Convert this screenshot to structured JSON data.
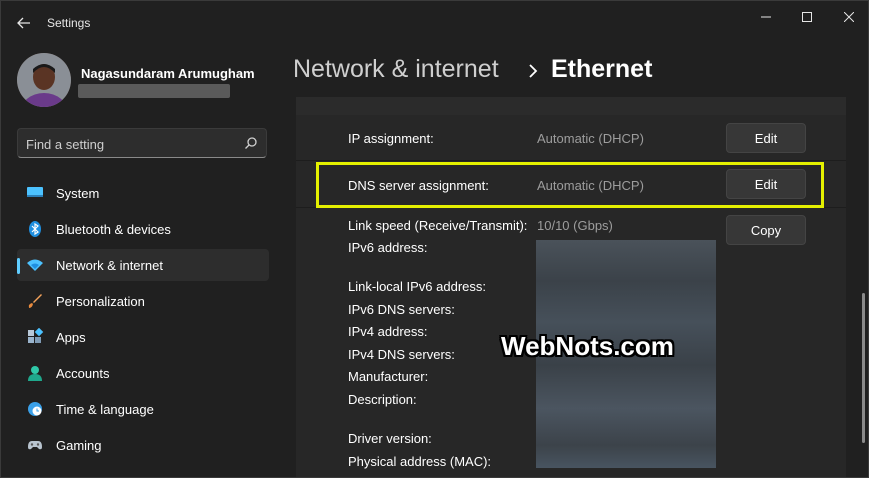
{
  "window": {
    "title": "Settings",
    "controls": {
      "minimize_icon": "minimize-icon",
      "maximize_icon": "maximize-icon",
      "close_icon": "close-icon"
    }
  },
  "user": {
    "name": "Nagasundaram Arumugham"
  },
  "search": {
    "placeholder": "Find a setting"
  },
  "sidebar": {
    "items": [
      {
        "label": "System",
        "icon": "monitor-icon",
        "active": false
      },
      {
        "label": "Bluetooth & devices",
        "icon": "bluetooth-icon",
        "active": false
      },
      {
        "label": "Network & internet",
        "icon": "wifi-icon",
        "active": true
      },
      {
        "label": "Personalization",
        "icon": "brush-icon",
        "active": false
      },
      {
        "label": "Apps",
        "icon": "apps-icon",
        "active": false
      },
      {
        "label": "Accounts",
        "icon": "person-icon",
        "active": false
      },
      {
        "label": "Time & language",
        "icon": "clock-globe-icon",
        "active": false
      },
      {
        "label": "Gaming",
        "icon": "gamepad-icon",
        "active": false
      }
    ]
  },
  "header": {
    "parent": "Network & internet",
    "current": "Ethernet"
  },
  "content": {
    "ip_assignment": {
      "label": "IP assignment:",
      "value": "Automatic (DHCP)",
      "button": "Edit"
    },
    "dns_assignment": {
      "label": "DNS server assignment:",
      "value": "Automatic (DHCP)",
      "button": "Edit"
    },
    "link_speed": {
      "label": "Link speed (Receive/Transmit):",
      "value": "10/10 (Gbps)"
    },
    "copy_button": "Copy",
    "properties": [
      "IPv6 address:",
      "Link-local IPv6 address:",
      "IPv6 DNS servers:",
      "IPv4 address:",
      "IPv4 DNS servers:",
      "Manufacturer:",
      "Description:",
      "Driver version:",
      "Physical address (MAC):"
    ]
  },
  "watermark": "WebNots.com",
  "colors": {
    "accent": "#60cdff",
    "highlight": "#e4f000",
    "background": "#202020",
    "panel": "#272727"
  }
}
